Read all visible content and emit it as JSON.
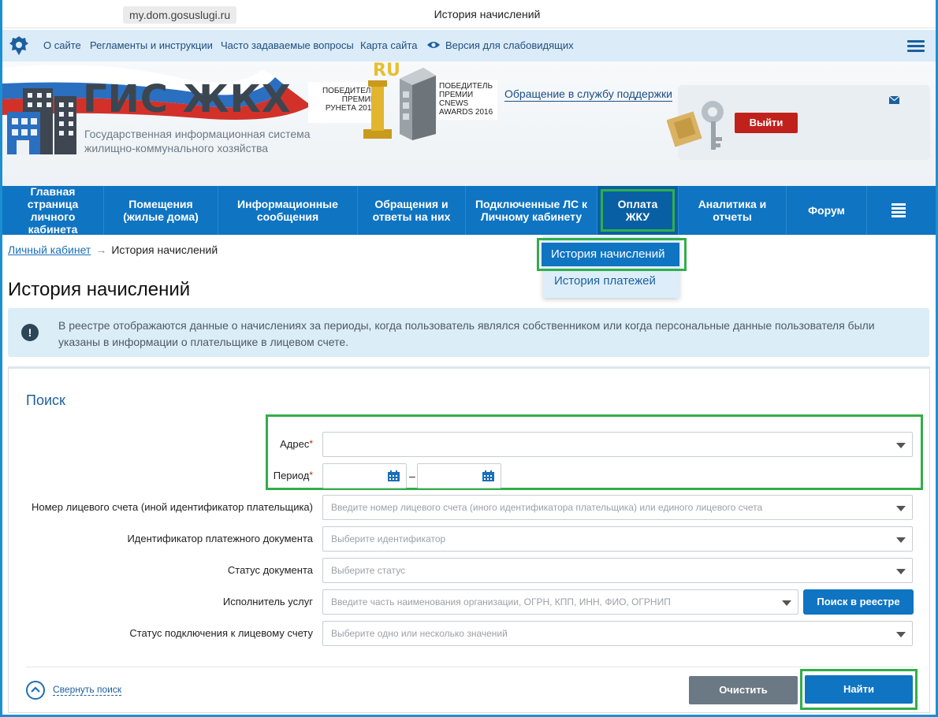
{
  "browser": {
    "url": "my.dom.gosuslugi.ru",
    "window_title": "История начислений"
  },
  "topbar": {
    "links": [
      "О сайте",
      "Регламенты и инструкции",
      "Часто задаваемые вопросы",
      "Карта сайта"
    ],
    "accessibility": "Версия для слабовидящих"
  },
  "header": {
    "logo_title": "ГИС ЖКХ",
    "logo_sub1": "Государственная информационная система",
    "logo_sub2": "жилищно-коммунального хозяйства",
    "award1": [
      "ПОБЕДИТЕЛЬ",
      "ПРЕМИИ",
      "РУНЕТА 2017"
    ],
    "award1_badge": "RU",
    "award2": [
      "ПОБЕДИТЕЛЬ",
      "ПРЕМИИ",
      "CNEWS",
      "AWARDS 2016"
    ],
    "support_link": "Обращение в службу поддержки",
    "exit_button": "Выйти"
  },
  "nav": {
    "items": [
      "Главная страница личного кабинета",
      "Помещения (жилые дома)",
      "Информационные сообщения",
      "Обращения и ответы на них",
      "Подключенные ЛС к Личному кабинету",
      "Оплата ЖКУ",
      "Аналитика и отчеты",
      "Форум"
    ]
  },
  "breadcrumb": {
    "link": "Личный кабинет",
    "arrow": "→",
    "current": "История начислений"
  },
  "dropdown": {
    "items": [
      "История начислений",
      "История платежей"
    ]
  },
  "page_title": "История начислений",
  "alert": {
    "text": "В реестре отображаются данные о начислениях за периоды, когда пользователь являлся собственником или когда персональные данные пользователя были указаны в информации о плательщике в лицевом счете."
  },
  "search": {
    "title": "Поиск",
    "address_label": "Адрес",
    "period_label": "Период",
    "required_mark": "*",
    "period_dash": "–",
    "account_label": "Номер лицевого счета (иной идентификатор плательщика)",
    "account_placeholder": "Введите номер лицевого счета (иного идентификатора плательщика) или единого лицевого счета",
    "docid_label": "Идентификатор платежного документа",
    "docid_placeholder": "Выберите идентификатор",
    "status_label": "Статус документа",
    "status_placeholder": "Выберите статус",
    "provider_label": "Исполнитель услуг",
    "provider_placeholder": "Введите часть наименования организации, ОГРН, КПП, ИНН, ФИО, ОГРНИП",
    "registry_button": "Поиск в реестре",
    "connection_label": "Статус подключения к лицевому счету",
    "connection_placeholder": "Выберите одно или несколько значений",
    "collapse_label": "Свернуть поиск",
    "clear_button": "Очистить",
    "find_button": "Найти"
  },
  "colors": {
    "primary": "#0f74c2",
    "highlight": "#31ae4a",
    "danger": "#c0221b",
    "muted_button": "#6b7985"
  }
}
